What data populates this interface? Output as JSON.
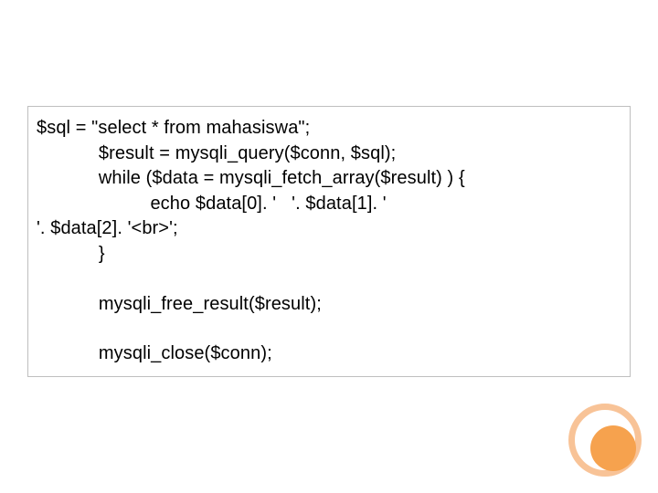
{
  "code": {
    "l1": "$sql = \"select * from mahasiswa\";",
    "l2": "            $result = mysqli_query($conn, $sql);",
    "l3": "            while ($data = mysqli_fetch_array($result) ) {",
    "l4": "                      echo $data[0]. '   '. $data[1]. '",
    "l5": "'. $data[2]. '<br>';",
    "l6": "            }",
    "l7": "            mysqli_free_result($result);",
    "l8": "            mysqli_close($conn);"
  }
}
